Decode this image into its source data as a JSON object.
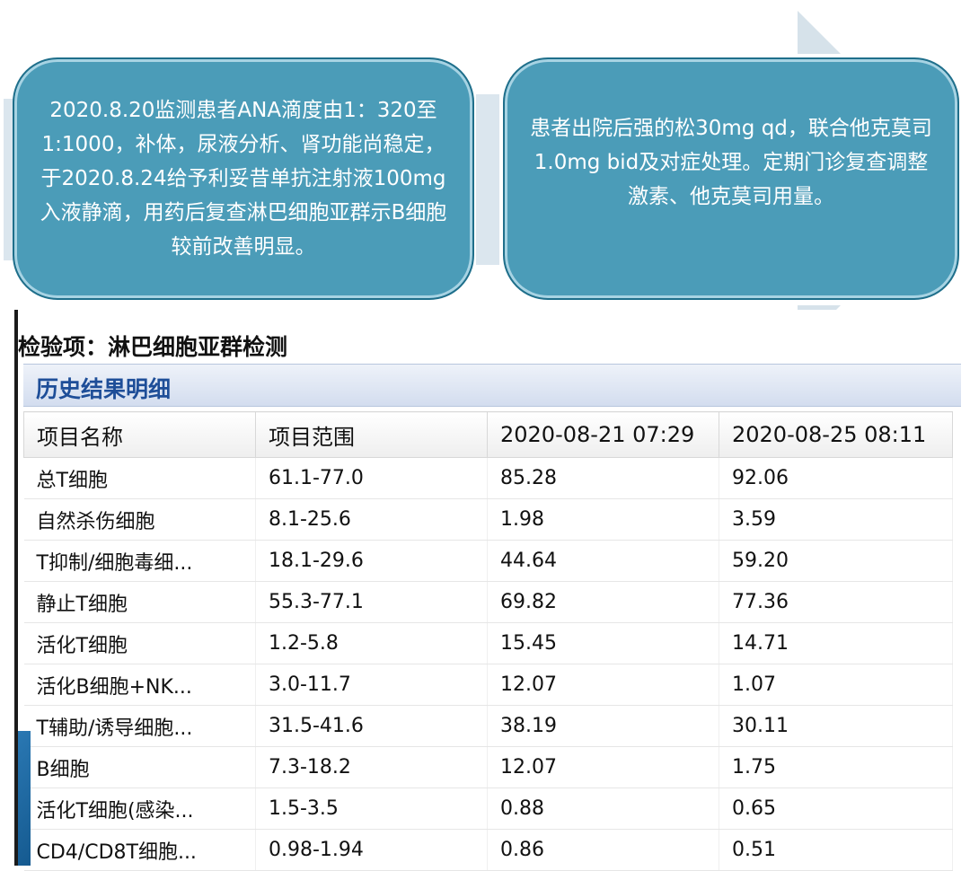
{
  "callouts": {
    "left": "2020.8.20监测患者ANA滴度由1：320至1:1000，补体，尿液分析、肾功能尚稳定，于2020.8.24给予利妥昔单抗注射液100mg入液静滴，用药后复查淋巴细胞亚群示B细胞较前改善明显。",
    "right": "患者出院后强的松30mg qd，联合他克莫司1.0mg bid及对症处理。定期门诊复查调整激素、他克莫司用量。"
  },
  "lab": {
    "title": "检验项：淋巴细胞亚群检测",
    "history_label": "历史结果明细",
    "columns": [
      "项目名称",
      "项目范围",
      "2020-08-21 07:29",
      "2020-08-25 08:11"
    ],
    "rows": [
      {
        "name": "总T细胞",
        "range": "61.1-77.0",
        "v1": "85.28",
        "s1": "hi",
        "v2": "92.06",
        "s2": "hi"
      },
      {
        "name": "自然杀伤细胞",
        "range": "8.1-25.6",
        "v1": "1.98",
        "s1": "lo",
        "v2": "3.59",
        "s2": "lo"
      },
      {
        "name": "T抑制/细胞毒细...",
        "range": "18.1-29.6",
        "v1": "44.64",
        "s1": "hi",
        "v2": "59.20",
        "s2": "hi"
      },
      {
        "name": "静止T细胞",
        "range": "55.3-77.1",
        "v1": "69.82",
        "s1": "norm",
        "v2": "77.36",
        "s2": "hi"
      },
      {
        "name": "活化T细胞",
        "range": "1.2-5.8",
        "v1": "15.45",
        "s1": "hi",
        "v2": "14.71",
        "s2": "hi"
      },
      {
        "name": "活化B细胞+NK...",
        "range": "3.0-11.7",
        "v1": "12.07",
        "s1": "hi",
        "v2": "1.07",
        "s2": "lo"
      },
      {
        "name": "T辅助/诱导细胞...",
        "range": "31.5-41.6",
        "v1": "38.19",
        "s1": "norm",
        "v2": "30.11",
        "s2": "lo"
      },
      {
        "name": "B细胞",
        "range": "7.3-18.2",
        "v1": "12.07",
        "s1": "norm",
        "v2": "1.75",
        "s2": "lo"
      },
      {
        "name": "活化T细胞(感染...",
        "range": "1.5-3.5",
        "v1": "0.88",
        "s1": "lo",
        "v2": "0.65",
        "s2": "lo"
      },
      {
        "name": "CD4/CD8T细胞...",
        "range": "0.98-1.94",
        "v1": "0.86",
        "s1": "lo",
        "v2": "0.51",
        "s2": "lo"
      }
    ]
  },
  "colors": {
    "high": "#e8423a",
    "low": "#2d8a2d",
    "normal": "#1a1a1a",
    "callout": "#4b9cb8"
  }
}
